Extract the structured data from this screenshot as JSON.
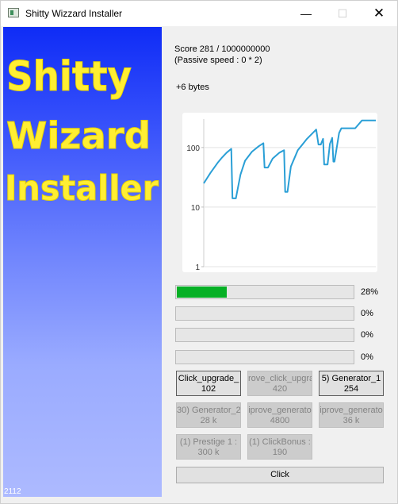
{
  "window": {
    "title": "Shitty Wizzard Installer",
    "minimize_glyph": "—",
    "maximize_glyph": "☐",
    "close_glyph": "✕"
  },
  "banner": {
    "logo_lines": [
      "Shitty",
      "Wizard",
      "Installer"
    ],
    "counter": "2112",
    "logo_color": "#ffee33"
  },
  "status": {
    "score": "Score 281 / 1000000000",
    "passive": "(Passive speed : 0 * 2)",
    "gain": "+6 bytes"
  },
  "chart_data": {
    "type": "line",
    "y_scale": "log",
    "y_ticks": [
      "100",
      "10",
      "1"
    ],
    "ylim": [
      1,
      300
    ],
    "grid": true,
    "series": [
      {
        "color": "#2a9fd6",
        "points": [
          [
            0,
            25
          ],
          [
            3,
            38
          ],
          [
            6,
            55
          ],
          [
            8,
            68
          ],
          [
            10,
            82
          ],
          [
            12,
            95
          ],
          [
            12.5,
            14
          ],
          [
            14,
            14
          ],
          [
            16,
            35
          ],
          [
            18,
            60
          ],
          [
            21,
            85
          ],
          [
            24,
            105
          ],
          [
            26,
            118
          ],
          [
            26.5,
            46
          ],
          [
            28,
            46
          ],
          [
            30,
            65
          ],
          [
            33,
            82
          ],
          [
            35,
            90
          ],
          [
            35.5,
            18
          ],
          [
            36.5,
            18
          ],
          [
            38,
            48
          ],
          [
            41,
            90
          ],
          [
            45,
            140
          ],
          [
            49,
            200
          ],
          [
            50,
            112
          ],
          [
            51,
            112
          ],
          [
            52,
            140
          ],
          [
            52.5,
            52
          ],
          [
            54,
            52
          ],
          [
            55,
            115
          ],
          [
            56,
            145
          ],
          [
            56.5,
            58
          ],
          [
            57,
            58
          ],
          [
            59,
            175
          ],
          [
            60,
            210
          ],
          [
            66,
            210
          ],
          [
            69,
            285
          ],
          [
            75,
            285
          ]
        ]
      }
    ],
    "xlim": [
      0,
      75
    ]
  },
  "progress": [
    {
      "value": 0.28,
      "label": "28%"
    },
    {
      "value": 0.0,
      "label": "0%"
    },
    {
      "value": 0.0,
      "label": "0%"
    },
    {
      "value": 0.0,
      "label": "0%"
    }
  ],
  "buttons": [
    {
      "line1": "Click_upgrade_",
      "line2": "102",
      "state": "enabled"
    },
    {
      "line1": "rove_click_upgra",
      "line2": "420",
      "state": "disabled"
    },
    {
      "line1": "5) Generator_1",
      "line2": "254",
      "state": "enabled"
    },
    {
      "line1": "30) Generator_2",
      "line2": "28 k",
      "state": "disabled"
    },
    {
      "line1": "iprove_generato",
      "line2": "4800",
      "state": "disabled"
    },
    {
      "line1": "iprove_generato",
      "line2": "36 k",
      "state": "disabled"
    },
    {
      "line1": "(1) Prestige 1 :",
      "line2": "300 k",
      "state": "disabled"
    },
    {
      "line1": "(1) ClickBonus :",
      "line2": "190",
      "state": "disabled"
    }
  ],
  "click_button": {
    "label": "Click"
  }
}
